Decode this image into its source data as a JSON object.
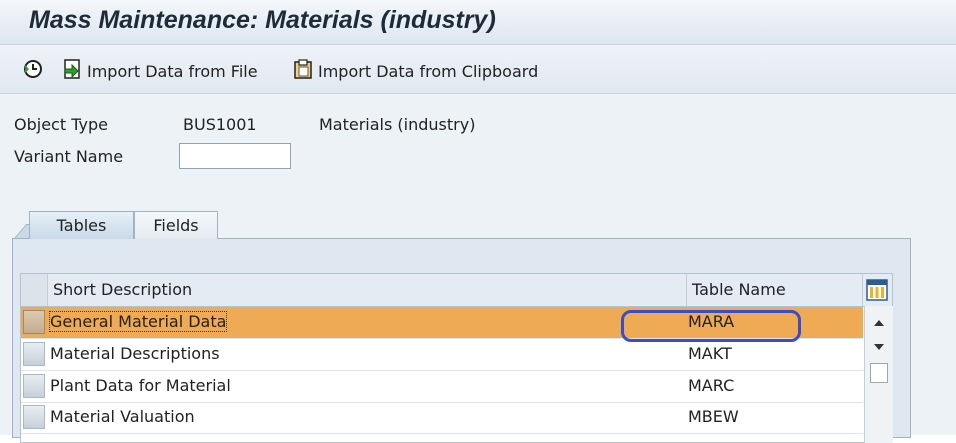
{
  "title": "Mass Maintenance: Materials (industry)",
  "toolbar": {
    "execute_icon": "clock-execute-icon",
    "import_file_label": "Import Data from File",
    "import_clipboard_label": "Import Data from Clipboard"
  },
  "form": {
    "object_type_label": "Object Type",
    "object_type_value": "BUS1001",
    "object_type_desc": "Materials (industry)",
    "variant_name_label": "Variant Name",
    "variant_name_value": ""
  },
  "tabs": [
    {
      "label": "Tables",
      "active": true
    },
    {
      "label": "Fields",
      "active": false
    }
  ],
  "table": {
    "columns": [
      "Short Description",
      "Table Name"
    ],
    "rows": [
      {
        "desc": "General Material Data",
        "name": "MARA",
        "selected": true
      },
      {
        "desc": "Material Descriptions",
        "name": "MAKT",
        "selected": false
      },
      {
        "desc": "Plant Data for Material",
        "name": "MARC",
        "selected": false
      },
      {
        "desc": "Material Valuation",
        "name": "MBEW",
        "selected": false
      }
    ]
  },
  "colors": {
    "selected_row": "#efaa55",
    "highlight_oval": "#3b4cc4",
    "background": "#edf2f7"
  }
}
